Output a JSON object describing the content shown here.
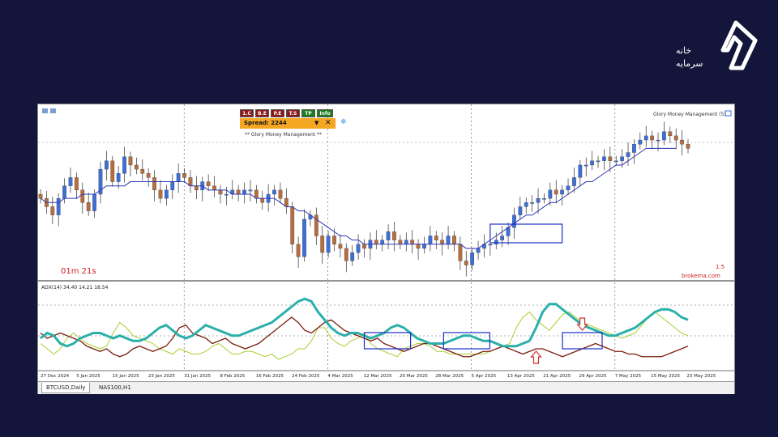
{
  "brand": {
    "line1": "خانه",
    "line2": "سرمایه",
    "logo_color": "#ffffff"
  },
  "chart_window": {
    "ea_buttons": [
      "1.C",
      "B.E",
      "P.E",
      "T.S",
      "TP",
      "Info"
    ],
    "spread_label": "Spread: 2244",
    "ea_title": "**  Glory Money Management  **",
    "top_right_label": "Glory Money Management (5)",
    "countdown": "01m 21s",
    "scale_label": "1.5",
    "broker_label": "brokema.com",
    "indicator_label": "ADX(14) 34.40 14.21 18.54",
    "tabs": [
      {
        "label": "BTCUSD,Daily",
        "active": true
      },
      {
        "label": "NAS100,H1",
        "active": false
      }
    ]
  },
  "colors": {
    "bull_candle": "#3d6fd6",
    "bear_candle": "#b86d3f",
    "ma": "#2d36b5",
    "adx": "#2aafaa",
    "plus_di": "#a8cf32",
    "minus_di": "#7a1f0f",
    "box": "#1a2ec8",
    "arrow": "#c9302c"
  },
  "chart_data": {
    "type": "candlestick",
    "symbol": "BTCUSD",
    "timeframe": "Daily",
    "x_tick_labels": [
      "27 Dec 2024",
      "5 Jan 2025",
      "15 Jan 2025",
      "23 Jan 2025",
      "31 Jan 2025",
      "8 Feb 2025",
      "16 Feb 2025",
      "24 Feb 2025",
      "4 Mar 2025",
      "12 Mar 2025",
      "20 Mar 2025",
      "28 Mar 2025",
      "5 Apr 2025",
      "13 Apr 2025",
      "21 Apr 2025",
      "29 Apr 2025",
      "7 May 2025",
      "15 May 2025",
      "23 May 2025"
    ],
    "closes": [
      95,
      93,
      91,
      95,
      98,
      100,
      97,
      94,
      92,
      96,
      102,
      104,
      99,
      101,
      105,
      103,
      102,
      101,
      100,
      97,
      95,
      97,
      99,
      101,
      100,
      98,
      97,
      99,
      98,
      97,
      96,
      96,
      97,
      96,
      97,
      97,
      95,
      94,
      96,
      97,
      95,
      93,
      84,
      81,
      90,
      91,
      86,
      82,
      86,
      84,
      83,
      80,
      82,
      84,
      83,
      85,
      84,
      85,
      87,
      85,
      84,
      85,
      84,
      83,
      84,
      86,
      85,
      84,
      86,
      84,
      80,
      79,
      82,
      83,
      84,
      84,
      85,
      86,
      88,
      91,
      93,
      94,
      94,
      95,
      95,
      97,
      96,
      97,
      98,
      100,
      103,
      103,
      104,
      104,
      105,
      104,
      104,
      105,
      106,
      108,
      109,
      110,
      109,
      109,
      111,
      110,
      109,
      108,
      107
    ],
    "ma_values": [
      95,
      94,
      94,
      94,
      95,
      95,
      95,
      96,
      96,
      96,
      97,
      98,
      98,
      98,
      98,
      99,
      99,
      99,
      99,
      99,
      99,
      99,
      99,
      99,
      99,
      98,
      98,
      98,
      97,
      97,
      97,
      97,
      96,
      96,
      96,
      96,
      95,
      95,
      95,
      95,
      94,
      93,
      93,
      92,
      92,
      91,
      90,
      89,
      88,
      87,
      86,
      86,
      85,
      85,
      84,
      84,
      84,
      84,
      84,
      84,
      84,
      84,
      84,
      84,
      84,
      84,
      84,
      84,
      84,
      84,
      84,
      83,
      83,
      83,
      84,
      85,
      86,
      87,
      88,
      89,
      90,
      91,
      91,
      92,
      93,
      94,
      94,
      95,
      96,
      97,
      98,
      99,
      99,
      100,
      101,
      102,
      103,
      103,
      104,
      105,
      106,
      107,
      107,
      107,
      107,
      107,
      107
    ],
    "adx": [
      20,
      22,
      21,
      18,
      17,
      18,
      20,
      21,
      22,
      22,
      21,
      20,
      21,
      20,
      19,
      19,
      20,
      22,
      24,
      25,
      23,
      21,
      20,
      21,
      23,
      25,
      24,
      23,
      22,
      21,
      21,
      22,
      23,
      24,
      25,
      26,
      28,
      30,
      32,
      34,
      35,
      34,
      30,
      27,
      24,
      22,
      21,
      22,
      22,
      21,
      20,
      21,
      22,
      24,
      25,
      24,
      22,
      20,
      19,
      18,
      18,
      18,
      19,
      20,
      21,
      21,
      20,
      19,
      19,
      18,
      17,
      17,
      17,
      18,
      19,
      24,
      30,
      33,
      33,
      31,
      29,
      27,
      25,
      24,
      23,
      22,
      21,
      21,
      22,
      23,
      24,
      26,
      28,
      30,
      31,
      31,
      30,
      28,
      27
    ],
    "plus_di": [
      18,
      16,
      14,
      16,
      20,
      22,
      20,
      18,
      17,
      16,
      17,
      22,
      26,
      24,
      21,
      20,
      19,
      18,
      16,
      15,
      14,
      16,
      15,
      14,
      14,
      15,
      17,
      18,
      16,
      14,
      14,
      15,
      15,
      14,
      13,
      14,
      12,
      13,
      14,
      16,
      16,
      19,
      24,
      24,
      20,
      18,
      17,
      19,
      20,
      22,
      18,
      16,
      15,
      14,
      13,
      16,
      17,
      18,
      18,
      17,
      15,
      15,
      14,
      14,
      14,
      14,
      14,
      14,
      15,
      16,
      17,
      18,
      24,
      28,
      30,
      27,
      25,
      23,
      26,
      29,
      30,
      28,
      26,
      25,
      24,
      23,
      22,
      21,
      20,
      21,
      22,
      25,
      28,
      30,
      28,
      26,
      24,
      22,
      21
    ],
    "minus_di": [
      22,
      20,
      21,
      22,
      21,
      20,
      19,
      17,
      16,
      15,
      16,
      14,
      13,
      14,
      16,
      17,
      16,
      15,
      16,
      17,
      20,
      24,
      25,
      22,
      21,
      20,
      18,
      19,
      20,
      18,
      17,
      16,
      17,
      18,
      20,
      22,
      24,
      26,
      28,
      26,
      23,
      22,
      24,
      26,
      27,
      25,
      23,
      22,
      21,
      20,
      19,
      20,
      18,
      17,
      16,
      15,
      16,
      17,
      18,
      18,
      17,
      16,
      15,
      14,
      13,
      13,
      14,
      15,
      15,
      16,
      17,
      16,
      15,
      14,
      15,
      16,
      16,
      15,
      14,
      13,
      14,
      15,
      16,
      17,
      18,
      17,
      16,
      15,
      15,
      14,
      14,
      13,
      13,
      13,
      13,
      14,
      15,
      16,
      17
    ],
    "annotations": [
      {
        "type": "box",
        "pane": "price",
        "from_index": 75,
        "to_index": 87
      },
      {
        "type": "box",
        "pane": "adx",
        "from_index": 49,
        "to_index": 56
      },
      {
        "type": "box",
        "pane": "adx",
        "from_index": 61,
        "to_index": 68
      },
      {
        "type": "box",
        "pane": "adx",
        "from_index": 79,
        "to_index": 85
      },
      {
        "type": "arrow",
        "direction": "down",
        "pane": "adx",
        "index": 82
      },
      {
        "type": "arrow",
        "direction": "up",
        "pane": "adx",
        "index": 75
      }
    ],
    "grid": true
  }
}
